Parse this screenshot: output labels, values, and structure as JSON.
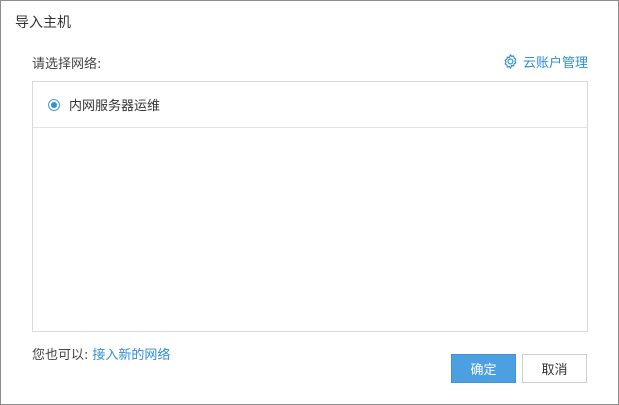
{
  "dialog": {
    "title": "导入主机",
    "choose_network_label": "请选择网络:",
    "cloud_account_link": "云账户管理",
    "cloud_account_icon": "gear-icon",
    "networks": [
      {
        "label": "内网服务器运维",
        "selected": true
      }
    ],
    "footer": {
      "prefix": "您也可以:",
      "link": "接入新的网络"
    },
    "buttons": {
      "ok": "确定",
      "cancel": "取消"
    }
  },
  "colors": {
    "accent": "#2f8fd8",
    "primary_button": "#4c9fe0",
    "border": "#d9d9d9"
  }
}
